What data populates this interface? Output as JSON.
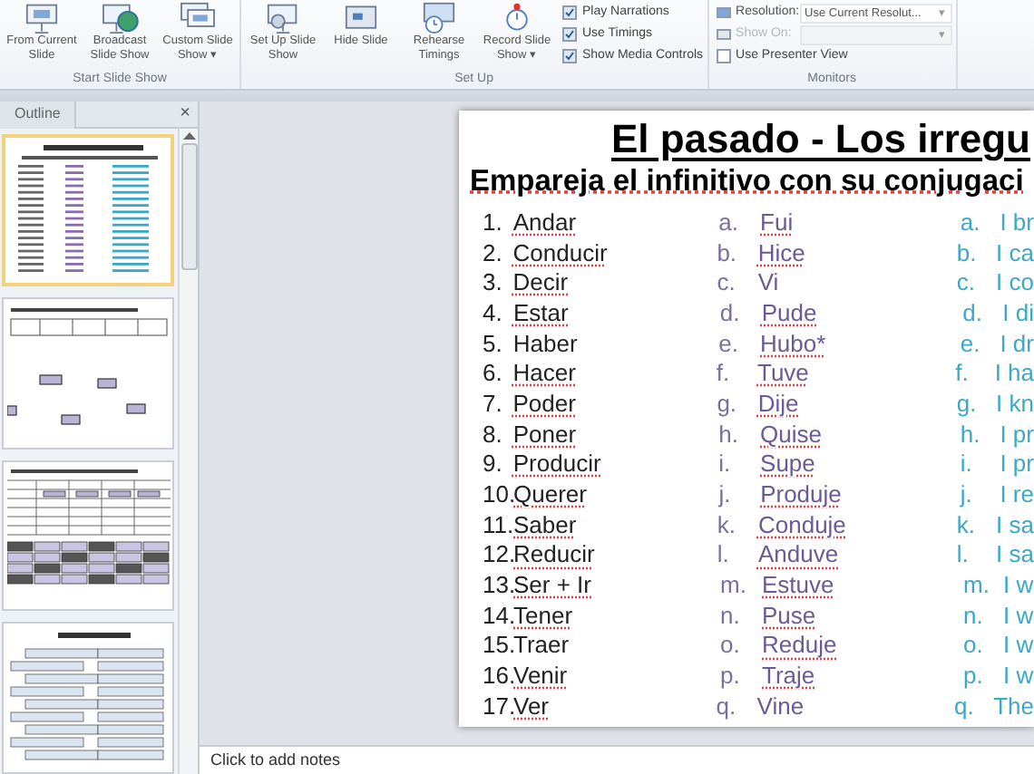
{
  "ribbon": {
    "groups": [
      {
        "label": "Start Slide Show",
        "buttons": [
          {
            "label": "From Current Slide"
          },
          {
            "label": "Broadcast Slide Show"
          },
          {
            "label": "Custom Slide Show",
            "arrow": "▾"
          }
        ]
      },
      {
        "label": "Set Up",
        "buttons": [
          {
            "label": "Set Up Slide Show"
          },
          {
            "label": "Hide Slide"
          },
          {
            "label": "Rehearse Timings"
          },
          {
            "label": "Record Slide Show",
            "arrow": "▾"
          }
        ],
        "checkboxes": [
          {
            "label": "Play Narrations",
            "checked": true
          },
          {
            "label": "Use Timings",
            "checked": true
          },
          {
            "label": "Show Media Controls",
            "checked": true
          }
        ]
      },
      {
        "label": "Monitors",
        "fields": [
          {
            "label": "Resolution:",
            "value": "Use Current Resolut...",
            "arrow": "▾",
            "disabled": false
          },
          {
            "label": "Show On:",
            "arrow": "▾",
            "disabled": true
          }
        ],
        "checkboxes": [
          {
            "label": "Use Presenter View",
            "checked": false
          }
        ]
      }
    ]
  },
  "pane": {
    "tab": "Outline",
    "close": "×",
    "thumbnails": [
      {
        "kind": "list",
        "selected": true
      },
      {
        "kind": "boxes",
        "selected": false
      },
      {
        "kind": "table",
        "selected": false
      },
      {
        "kind": "translate",
        "selected": false
      }
    ]
  },
  "slide": {
    "title": "El pasado - Los irregu",
    "subtitle": "Empareja el infinitivo con su conjugaci",
    "rows": [
      {
        "num": "1.",
        "verb": "Andar",
        "verb_flagged": true,
        "letter": "a.",
        "past": "Fui",
        "past_flagged": true,
        "letter_3": "a.",
        "english": "I br"
      },
      {
        "num": "2.",
        "verb": "Conducir",
        "verb_flagged": true,
        "letter": "b.",
        "past": "Hice",
        "past_flagged": true,
        "letter_3": "b.",
        "english": "I ca"
      },
      {
        "num": "3.",
        "verb": "Decir",
        "verb_flagged": true,
        "letter": "c.",
        "past": "Vi",
        "past_flagged": false,
        "letter_3": "c.",
        "english": "I co"
      },
      {
        "num": "4.",
        "verb": "Estar",
        "verb_flagged": true,
        "letter": "d.",
        "past": "Pude",
        "past_flagged": true,
        "letter_3": "d.",
        "english": "I di"
      },
      {
        "num": "5.",
        "verb": "Haber",
        "verb_flagged": false,
        "letter": "e.",
        "past": "Hubo*",
        "past_flagged": true,
        "letter_3": "e.",
        "english": "I dr"
      },
      {
        "num": "6.",
        "verb": "Hacer",
        "verb_flagged": true,
        "letter": "f.",
        "past": "Tuve",
        "past_flagged": true,
        "letter_3": "f.",
        "english": "I ha"
      },
      {
        "num": "7.",
        "verb": "Poder",
        "verb_flagged": true,
        "letter": "g.",
        "past": "Dije",
        "past_flagged": true,
        "letter_3": "g.",
        "english": "I kn"
      },
      {
        "num": "8.",
        "verb": "Poner",
        "verb_flagged": true,
        "letter": "h.",
        "past": "Quise",
        "past_flagged": true,
        "letter_3": "h.",
        "english": "I pr"
      },
      {
        "num": "9.",
        "verb": "Producir",
        "verb_flagged": true,
        "letter": "i.",
        "past": "Supe",
        "past_flagged": true,
        "letter_3": "i.",
        "english": "I pr"
      },
      {
        "num": "10.",
        "verb": "Querer",
        "verb_flagged": true,
        "letter": "j.",
        "past": "Produje",
        "past_flagged": true,
        "letter_3": "j.",
        "english": "I re"
      },
      {
        "num": "11.",
        "verb": "Saber",
        "verb_flagged": true,
        "letter": "k.",
        "past": "Conduje",
        "past_flagged": true,
        "letter_3": "k.",
        "english": "I sa"
      },
      {
        "num": "12.",
        "verb": "Reducir",
        "verb_flagged": true,
        "letter": "l.",
        "past": "Anduve",
        "past_flagged": true,
        "letter_3": "l.",
        "english": "I sa"
      },
      {
        "num": "13.",
        "verb": "Ser + Ir",
        "verb_flagged": true,
        "letter": "m.",
        "past": "Estuve",
        "past_flagged": true,
        "letter_3": "m.",
        "english": "I w"
      },
      {
        "num": "14.",
        "verb": "Tener",
        "verb_flagged": true,
        "letter": "n.",
        "past": "Puse",
        "past_flagged": true,
        "letter_3": "n.",
        "english": "I w"
      },
      {
        "num": "15.",
        "verb": "Traer",
        "verb_flagged": false,
        "letter": "o.",
        "past": "Reduje",
        "past_flagged": true,
        "letter_3": "o.",
        "english": "I w"
      },
      {
        "num": "16.",
        "verb": "Venir",
        "verb_flagged": true,
        "letter": "p.",
        "past": "Traje",
        "past_flagged": true,
        "letter_3": "p.",
        "english": "I w"
      },
      {
        "num": "17.",
        "verb": "Ver",
        "verb_flagged": true,
        "letter": "q.",
        "past": "Vine",
        "past_flagged": false,
        "letter_3": "q.",
        "english": "The"
      }
    ]
  },
  "notes": {
    "placeholder": "Click to add notes"
  }
}
